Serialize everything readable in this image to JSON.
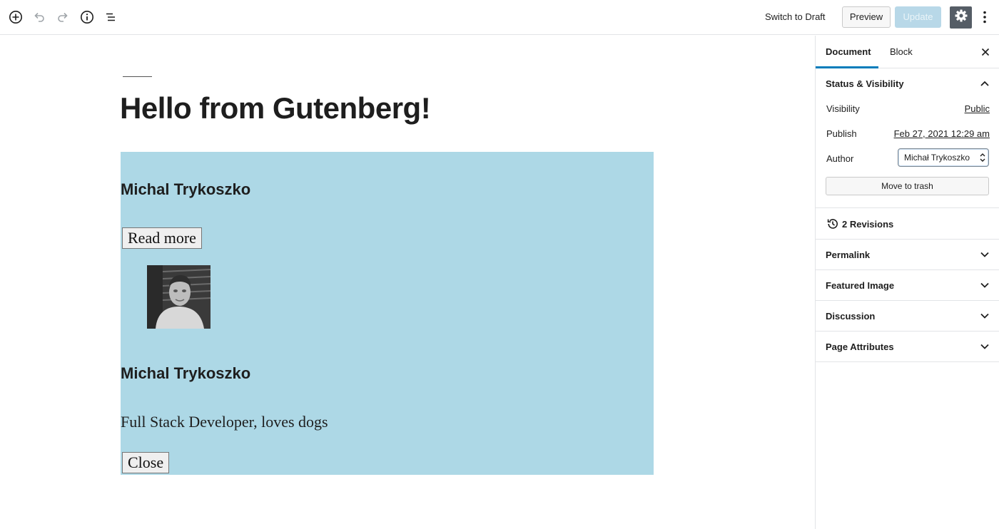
{
  "toolbar": {
    "switch_to_draft": "Switch to Draft",
    "preview": "Preview",
    "update": "Update",
    "icons": [
      "add-block-icon",
      "undo-icon",
      "redo-icon",
      "info-icon",
      "list-view-icon",
      "gear-icon",
      "more-vertical-icon"
    ]
  },
  "editor": {
    "title": "Hello from Gutenberg!",
    "block": {
      "background": "#add8e6",
      "heading_1": "Michal Trykoszko",
      "read_more": "Read more",
      "heading_2": "Michal Trykoszko",
      "bio": "Full Stack Developer, loves dogs",
      "close": "Close"
    }
  },
  "sidebar": {
    "tabs": [
      "Document",
      "Block"
    ],
    "active_tab": "Document",
    "status": {
      "title": "Status & Visibility",
      "visibility_label": "Visibility",
      "visibility_value": "Public",
      "publish_label": "Publish",
      "publish_value": "Feb 27, 2021 12:29 am",
      "author_label": "Author",
      "author_value": "Michał Trykoszko",
      "move_to_trash": "Move to trash"
    },
    "revisions": "2 Revisions",
    "panels": [
      "Permalink",
      "Featured Image",
      "Discussion",
      "Page Attributes"
    ]
  },
  "colors": {
    "accent": "#007cba",
    "update_disabled": "#b8d8e8",
    "settings_active": "#555d66"
  }
}
